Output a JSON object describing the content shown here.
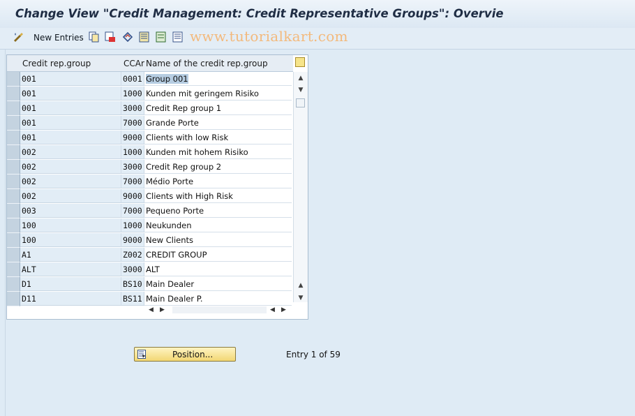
{
  "window": {
    "title": "Change View \"Credit Management: Credit Representative Groups\": Overvie"
  },
  "toolbar": {
    "new_entries_label": "New Entries",
    "icons": [
      "edit-icon",
      "copy-icon",
      "delete-icon",
      "undo-icon",
      "select-all-icon",
      "select-block-icon",
      "deselect-all-icon"
    ]
  },
  "watermark": "www.tutorialkart.com",
  "table": {
    "columns": [
      "Credit rep.group",
      "CCAr",
      "Name of the credit rep.group"
    ],
    "rows": [
      {
        "group": "001",
        "ccar": "0001",
        "name": "Group 001"
      },
      {
        "group": "001",
        "ccar": "1000",
        "name": "Kunden mit geringem Risiko"
      },
      {
        "group": "001",
        "ccar": "3000",
        "name": "Credit Rep group 1"
      },
      {
        "group": "001",
        "ccar": "7000",
        "name": "Grande Porte"
      },
      {
        "group": "001",
        "ccar": "9000",
        "name": "Clients with low Risk"
      },
      {
        "group": "002",
        "ccar": "1000",
        "name": "Kunden mit hohem Risiko"
      },
      {
        "group": "002",
        "ccar": "3000",
        "name": "Credit Rep group 2"
      },
      {
        "group": "002",
        "ccar": "7000",
        "name": "Médio Porte"
      },
      {
        "group": "002",
        "ccar": "9000",
        "name": "Clients with High Risk"
      },
      {
        "group": "003",
        "ccar": "7000",
        "name": "Pequeno Porte"
      },
      {
        "group": "100",
        "ccar": "1000",
        "name": "Neukunden"
      },
      {
        "group": "100",
        "ccar": "9000",
        "name": "New Clients"
      },
      {
        "group": "A1",
        "ccar": "Z002",
        "name": "CREDIT GROUP"
      },
      {
        "group": "ALT",
        "ccar": "3000",
        "name": "ALT"
      },
      {
        "group": "D1",
        "ccar": "BS10",
        "name": "Main Dealer"
      },
      {
        "group": "D11",
        "ccar": "BS11",
        "name": "Main Dealer P."
      }
    ]
  },
  "position_button": {
    "label": "Position..."
  },
  "entry_info": "Entry 1 of 59",
  "colors": {
    "accent_button": "#f2d774",
    "highlight": "#b6cde2",
    "watermark": "#f3b97c"
  }
}
